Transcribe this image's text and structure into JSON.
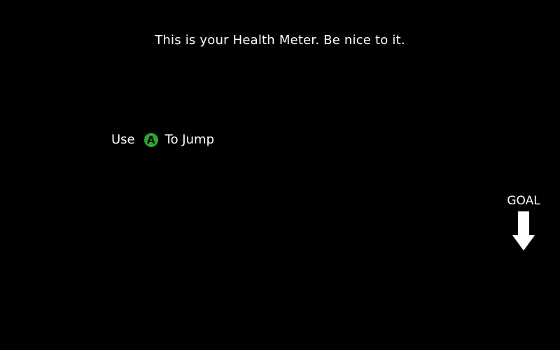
{
  "tutorial": {
    "health_message": "This is your Health Meter. Be nice to it.",
    "jump_hint": {
      "prefix": "Use",
      "button_glyph": "A",
      "button_color": "#2fa32f",
      "suffix": "To Jump",
      "button_icon": "a-button-icon"
    }
  },
  "goal": {
    "label": "GOAL",
    "icon": "down-arrow-icon"
  },
  "colors": {
    "background": "#000000",
    "text": "#ffffff"
  }
}
